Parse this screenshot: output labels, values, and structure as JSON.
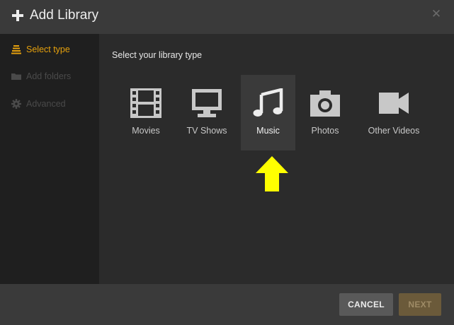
{
  "header": {
    "title": "Add Library",
    "close_glyph": "✕",
    "plus_icon": "plus-icon",
    "close_icon": "close-icon"
  },
  "sidebar": {
    "items": [
      {
        "label": "Select type",
        "icon": "stack-icon",
        "active": true
      },
      {
        "label": "Add folders",
        "icon": "folder-icon",
        "active": false
      },
      {
        "label": "Advanced",
        "icon": "gear-icon",
        "active": false
      }
    ]
  },
  "main": {
    "prompt": "Select your library type",
    "types": [
      {
        "label": "Movies",
        "icon": "film-icon",
        "selected": false
      },
      {
        "label": "TV Shows",
        "icon": "monitor-icon",
        "selected": false
      },
      {
        "label": "Music",
        "icon": "music-note-icon",
        "selected": true
      },
      {
        "label": "Photos",
        "icon": "camera-icon",
        "selected": false
      },
      {
        "label": "Other Videos",
        "icon": "video-camera-icon",
        "selected": false
      }
    ],
    "annotation_icon": "yellow-arrow-up-icon"
  },
  "footer": {
    "cancel_label": "CANCEL",
    "next_label": "NEXT"
  },
  "colors": {
    "accent": "#e5a00d",
    "header_bg": "#3a3a3a",
    "sidebar_bg": "#1f1f1f",
    "content_bg": "#2b2b2b",
    "selected_card_bg": "#3a3a3a",
    "icon": "#c8c8c8",
    "annotation_arrow": "#ffff00",
    "cancel_bg": "#595959",
    "next_bg": "#6b5a3a"
  }
}
